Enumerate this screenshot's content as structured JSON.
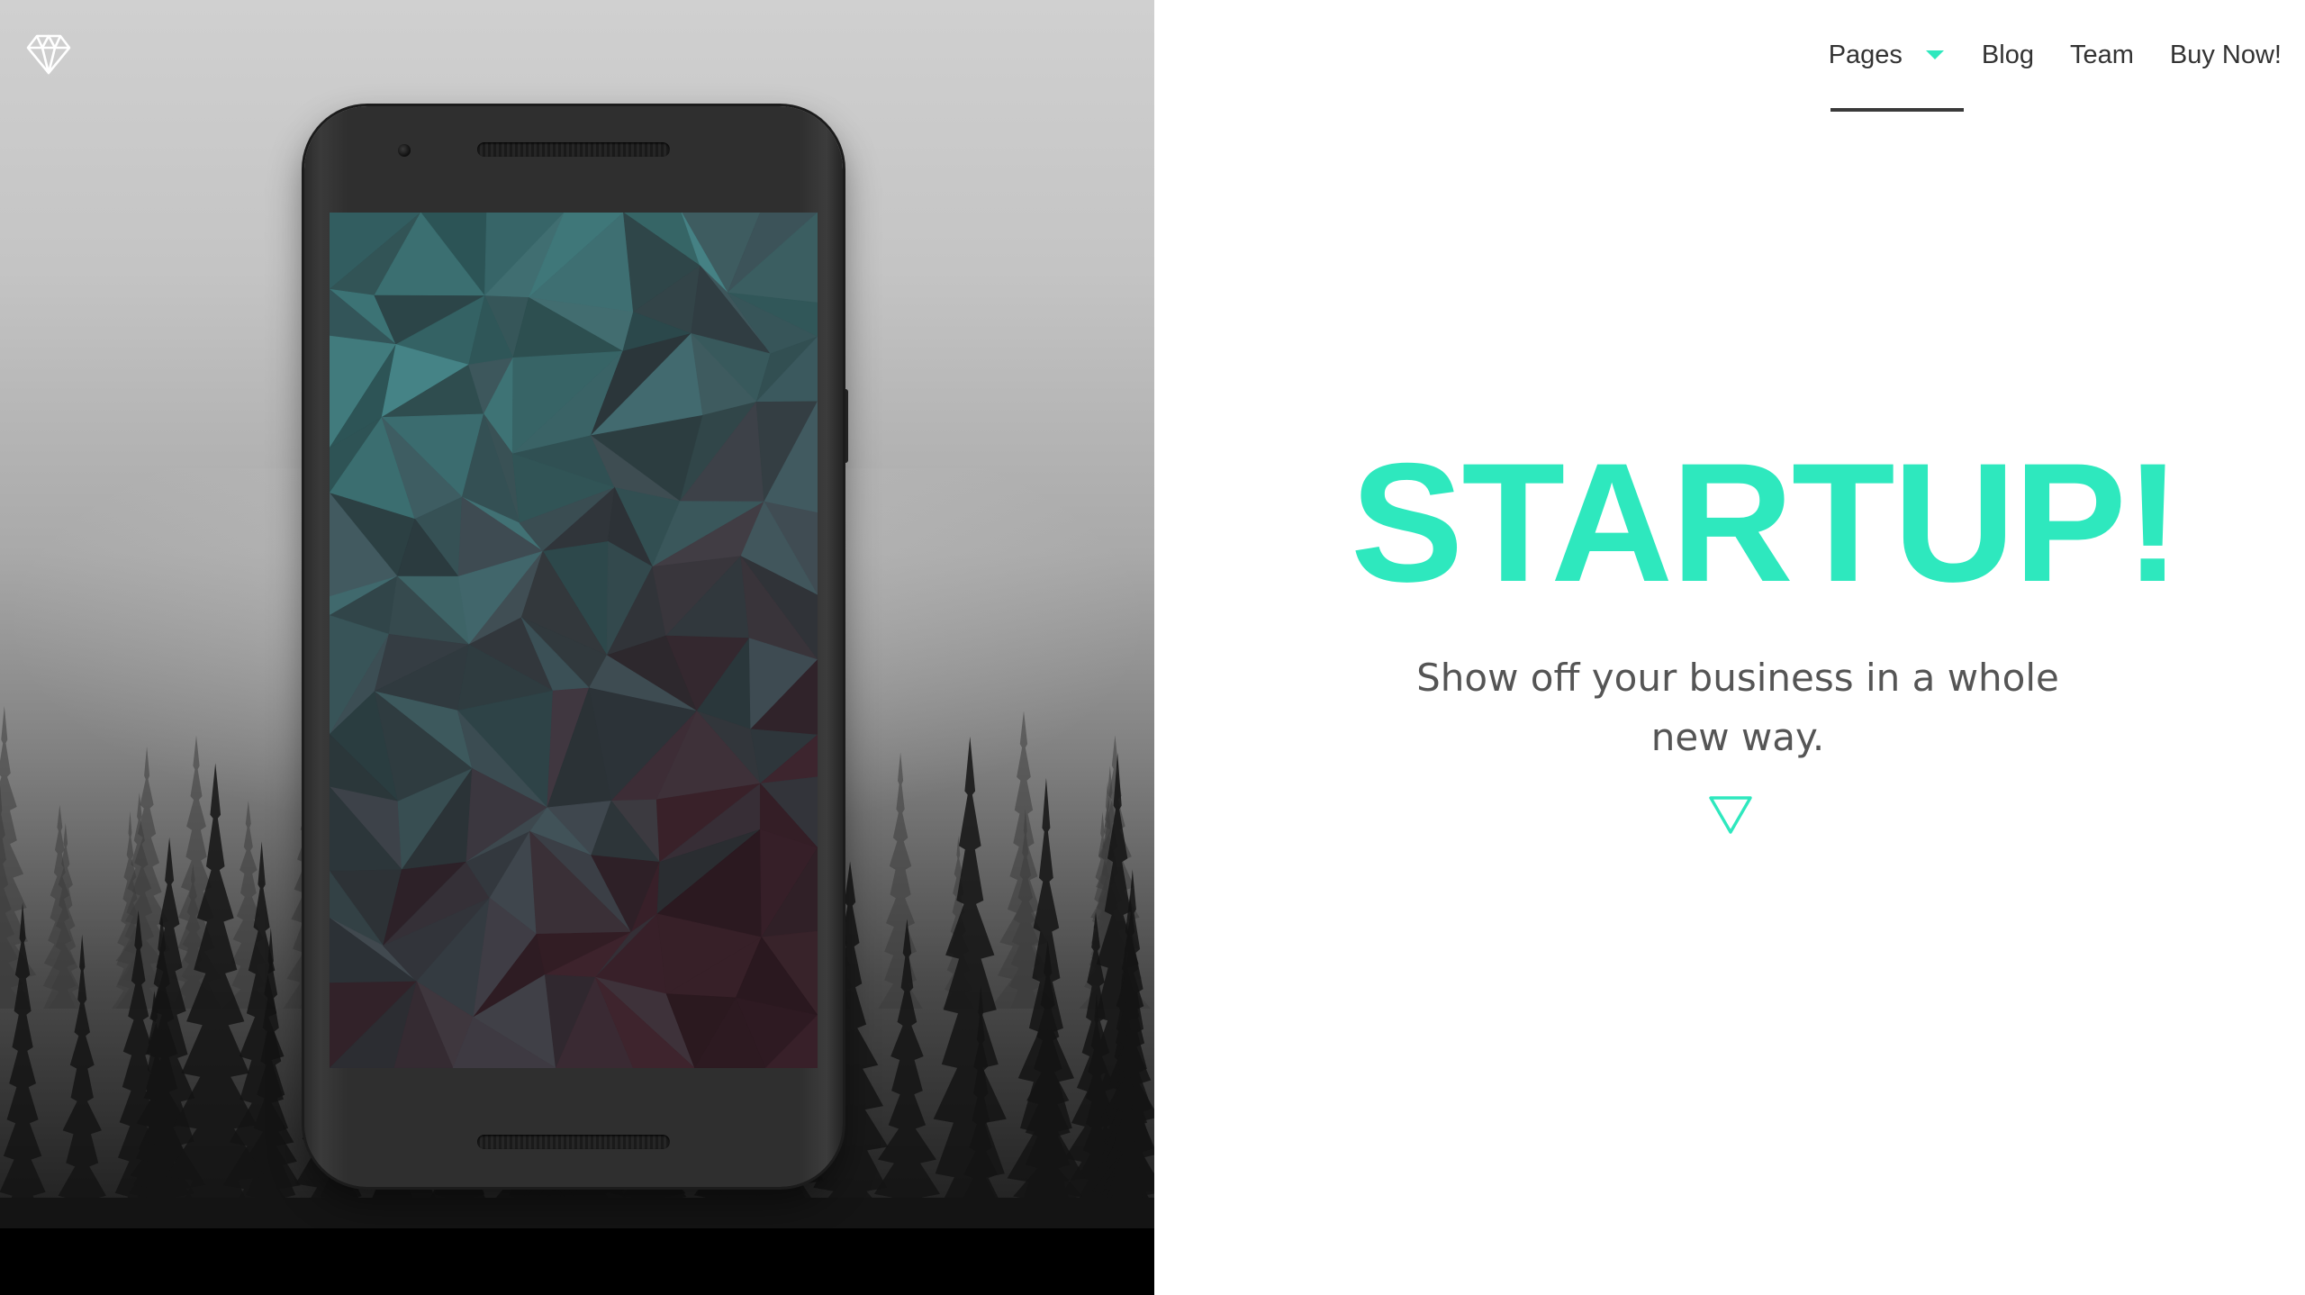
{
  "nav": {
    "items": [
      {
        "label": "Pages",
        "has_dropdown": true,
        "active": true
      },
      {
        "label": "Blog"
      },
      {
        "label": "Team"
      },
      {
        "label": "Buy Now!"
      }
    ]
  },
  "hero": {
    "title": "STARTUP!",
    "subtitle": "Show off your business in a whole new way."
  },
  "icons": {
    "logo": "diamond-icon",
    "dropdown": "caret-down-icon",
    "scroll": "triangle-down-icon"
  },
  "colors": {
    "accent": "#2ee8be",
    "nav_text": "#333333",
    "subtitle_text": "#555555",
    "background": "#ffffff"
  }
}
